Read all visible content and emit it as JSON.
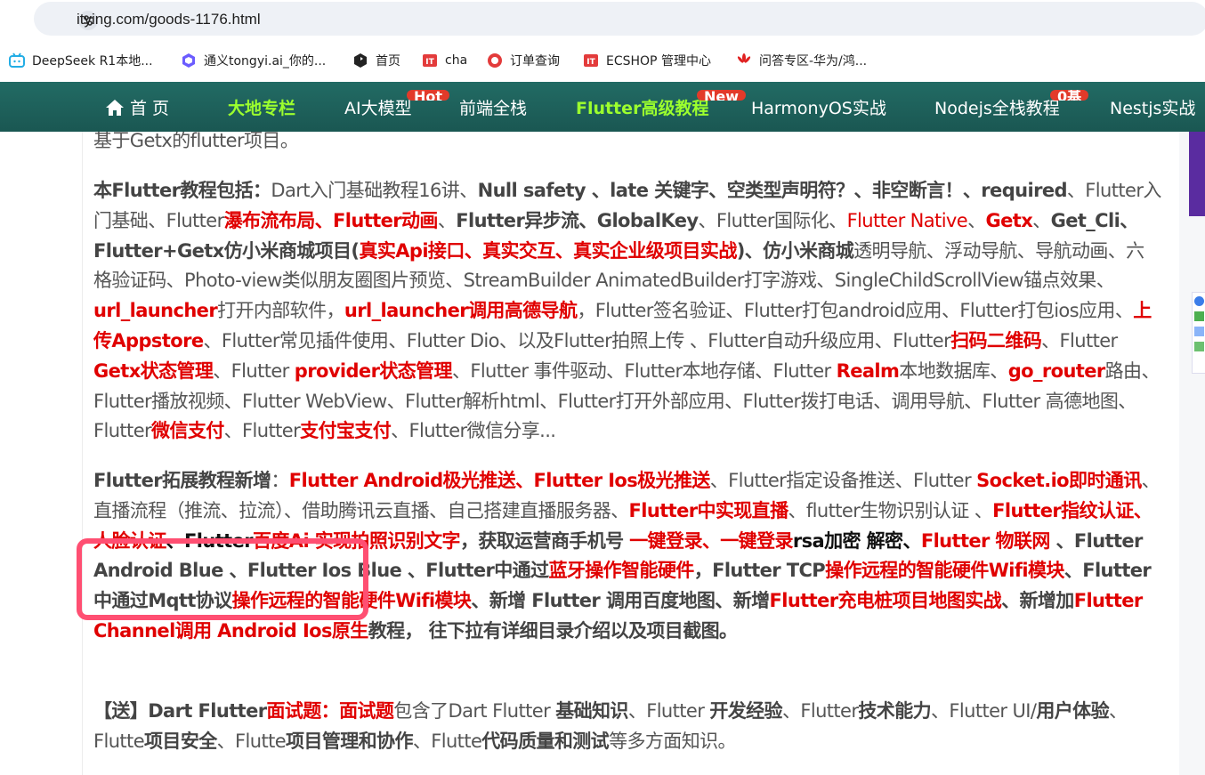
{
  "browser": {
    "url": "itying.com/goods-1176.html",
    "bookmarks": [
      {
        "label": "DeepSeek R1本地...",
        "icon": "bilibili-icon",
        "color": "#23ade5"
      },
      {
        "label": "通义tongyi.ai_你的...",
        "icon": "tongyi-icon",
        "color": "#6b5cff"
      },
      {
        "label": "首页",
        "icon": "cursor-logo-icon",
        "color": "#222222"
      },
      {
        "label": "cha",
        "icon": "itying-icon",
        "color": "#e33b3b"
      },
      {
        "label": "订单查询",
        "icon": "order-icon",
        "color": "#e33b3b"
      },
      {
        "label": "ECSHOP 管理中心",
        "icon": "itying-icon",
        "color": "#e33b3b"
      },
      {
        "label": "问答专区-华为/鸿...",
        "icon": "huawei-icon",
        "color": "#e02020"
      }
    ]
  },
  "nav": {
    "home": "首 页",
    "items": [
      "大地专栏",
      "AI大模型",
      "前端全栈",
      "Flutter高级教程",
      "HarmonyOS实战",
      "Nodejs全栈教程",
      "Nestjs实战"
    ],
    "badges": [
      "Hot",
      "New",
      "0基"
    ]
  },
  "p0": {
    "t1": "基于Getx的flutter项目。"
  },
  "p1": {
    "a": "本Flutter教程包括：",
    "b": "Dart入门基础教程16讲、",
    "c": "Null safety 、late 关键字、空类型声明符？、非空断言！、required",
    "d": "、Flutter入门基础、Flutter",
    "e": "瀑布流布局、Flutter动画",
    "f": "、",
    "g": "Flutter异步流、GlobalKey",
    "h": "、Flutter国际化、",
    "i": "Flutter Native",
    "j": "、",
    "k": "Getx",
    "l": "、",
    "m": "Get_Cli、Flutter+Getx仿小米商城项目(",
    "n": "真实Api接口、真实交互、真实企业级项目实战",
    "o": ")、",
    "p": "仿小米商城",
    "q": "透明导航、浮动导航、导航动画、六格验证码、Photo-view类似朋友圈图片预览、StreamBuilder  AnimatedBuilder打字游戏、SingleChildScrollView锚点效果、",
    "r": "url_launcher",
    "s": "打开内部软件，",
    "t": "url_launcher调用高德导航",
    "u": "，Flutter签名验证、Flutter打包android应用、Flutter打包ios应用、",
    "v": "上传Appstore",
    "w": "、Flutter常见插件使用、Flutter Dio、以及Flutter拍照上传 、Flutter自动升级应用、Flutter",
    "x": "扫码二维码",
    "y": "、Flutter ",
    "z": "Getx状态管理",
    "aa": "、Flutter ",
    "ab": "provider状态管理",
    "ac": "、Flutter 事件驱动、Flutter本地存储、Flutter ",
    "ad": "Realm",
    "ae": "本地数据库、",
    "af": "go_router",
    "ag": "路由、Flutter播放视频、Flutter WebView、Flutter解析html、Flutter打开外部应用、Flutter拨打电话、调用导航、Flutter 高德地图、Flutter",
    "ah": "微信支付",
    "ai": "、Flutter",
    "aj": "支付宝支付",
    "ak": "、Flutter微信分享..."
  },
  "p2": {
    "a": "Flutter拓展教程新增",
    "b": "：",
    "c": "Flutter Android极光推送、Flutter Ios极光推送",
    "d": "、Flutter指定设备推送、Flutter ",
    "e": "Socket.io即时通讯",
    "f": "、直播流程（推流、拉流）、借助腾讯云直播、自己搭建直播服务器、",
    "g": "Flutter中实现直播",
    "h": "、flutter生物识别认证 、",
    "i": "Flutter指纹认证、人脸认证",
    "j": "、",
    "k": "Flutter",
    "l": "百度Ai 实现拍照识别文字",
    "m": "，获取运营商手机号 ",
    "n": "一键登录、一键登录",
    "o": "rsa加密 解密、",
    "p": "Flutter 物联网",
    "q": " 、Flutter Android Blue 、Flutter Ios Blue 、Flutter中通过",
    "r": "蓝牙操作智能硬件",
    "s": "，Flutter TCP",
    "t": "操作远程的智能硬件Wifi模块",
    "u": "、Flutter中通过Mqtt协议",
    "v": "操作远程的智能硬件Wifi模块",
    "w": "、新增 Flutter 调用百度地图、新增",
    "x": "Flutter充电桩项目地图实战",
    "y": "、新增加",
    "z": "Flutter Channel调用 Android Ios原生",
    "aa": "教程， 往下拉有详细目录介绍以及项目截图。"
  },
  "p3": {
    "a": "【送】Dart Flutter",
    "b": "面试题：面试题",
    "c": "包含了Dart Flutter ",
    "d": "基础知识",
    "e": "、Flutter ",
    "f": "开发经验",
    "g": "、Flutter",
    "h": "技术能力",
    "i": "、Flutter UI/",
    "j": "用户体验",
    "k": "、Flutte",
    "l": "项目安全",
    "m": "、Flutte",
    "n": "项目管理和协作",
    "o": "、Flutte",
    "p": "代码质量和测试",
    "q": "等多方面知识。"
  }
}
